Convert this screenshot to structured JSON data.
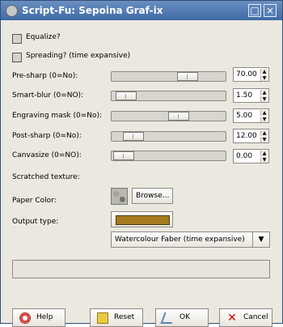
{
  "window": {
    "title": "Script-Fu: Sepoina Graf-ix",
    "minimize_label": "□",
    "close_label": "×"
  },
  "checks": [
    {
      "label": "Equalize?",
      "checked": false
    },
    {
      "label": "Spreading? (time expansive)",
      "checked": false
    }
  ],
  "sliders": [
    {
      "label": "Pre-sharp (0=No):",
      "value": "70.00"
    },
    {
      "label": "Smart-blur (0=NO):",
      "value": "1.50"
    },
    {
      "label": "Engraving mask (0=No):",
      "value": "5.00"
    },
    {
      "label": "Post-sharp (0=No):",
      "value": "12.00"
    },
    {
      "label": "Canvasize (0=NO):",
      "value": "0.00"
    }
  ],
  "texture": {
    "label": "Scratched texture:",
    "browse": "Browse..."
  },
  "paper": {
    "label": "Paper Color:",
    "color": "#a57a20"
  },
  "output": {
    "label": "Output type:",
    "selected": "Watercolour Faber (time expansive)"
  },
  "buttons": {
    "help": "Help",
    "reset": "Reset",
    "ok": "OK",
    "cancel": "Cancel"
  }
}
